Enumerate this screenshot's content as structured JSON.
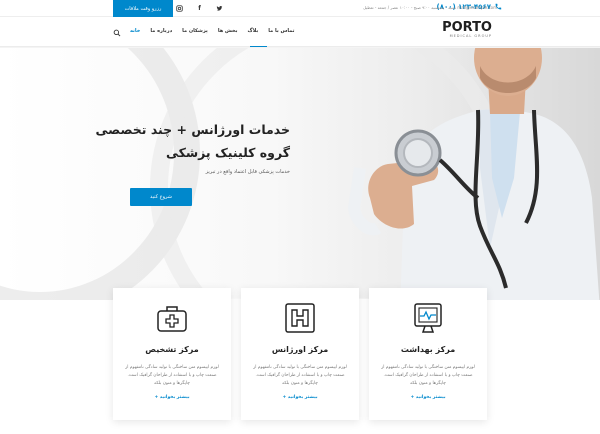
{
  "topbar": {
    "phone": "(۸۰۰) ۱۲۳-۴۵۶۷",
    "info": "mail@example.com    شنبه - پنجشنبه ۹:۰۰ صبح - ۱۰:۰۰ عصر / جمعه - تعطیل",
    "social": [
      "instagram",
      "facebook",
      "twitter"
    ],
    "cta_label": "رزرو وقت ملاقات"
  },
  "header": {
    "logo_main": "PORTO",
    "logo_sub": "MEDICAL GROUP",
    "nav": [
      {
        "label": "خانه",
        "active": true
      },
      {
        "label": "درباره ما",
        "active": false
      },
      {
        "label": "پزشکان ما",
        "active": false
      },
      {
        "label": "بخش ها",
        "active": false
      },
      {
        "label": "بلاگ",
        "active": false
      },
      {
        "label": "تماس با ما",
        "active": false
      }
    ]
  },
  "hero": {
    "title_line1": "خدمات اورژانس + چند تخصصی",
    "title_line2": "گروه کلینیک پزشکی",
    "subtitle": "خدمات پزشکی قابل اعتماد واقع در تبریز",
    "button_label": "شروع کنید"
  },
  "cards": [
    {
      "icon": "medical-kit-icon",
      "title": "مرکز تشخیص",
      "text": "لورم ایپسوم متن ساختگی با تولید سادگی نامفهوم از صنعت چاپ و با استفاده از طراحان گرافیک است. چاپگرها و متون بلکه",
      "link": "بیشتر بخوانید +"
    },
    {
      "icon": "hospital-icon",
      "title": "مرکز اورژانس",
      "text": "لورم ایپسوم متن ساختگی با تولید سادگی نامفهوم از صنعت چاپ و با استفاده از طراحان گرافیک است. چاپگرها و متون بلکه",
      "link": "بیشتر بخوانید +"
    },
    {
      "icon": "heart-monitor-icon",
      "title": "مرکز بهداشت",
      "text": "لورم ایپسوم متن ساختگی با تولید سادگی نامفهوم از صنعت چاپ و با استفاده از طراحان گرافیک است. چاپگرها و متون بلکه",
      "link": "بیشتر بخوانید +"
    }
  ],
  "colors": {
    "accent": "#0088cc",
    "text_dark": "#222222",
    "text_muted": "#777777"
  }
}
